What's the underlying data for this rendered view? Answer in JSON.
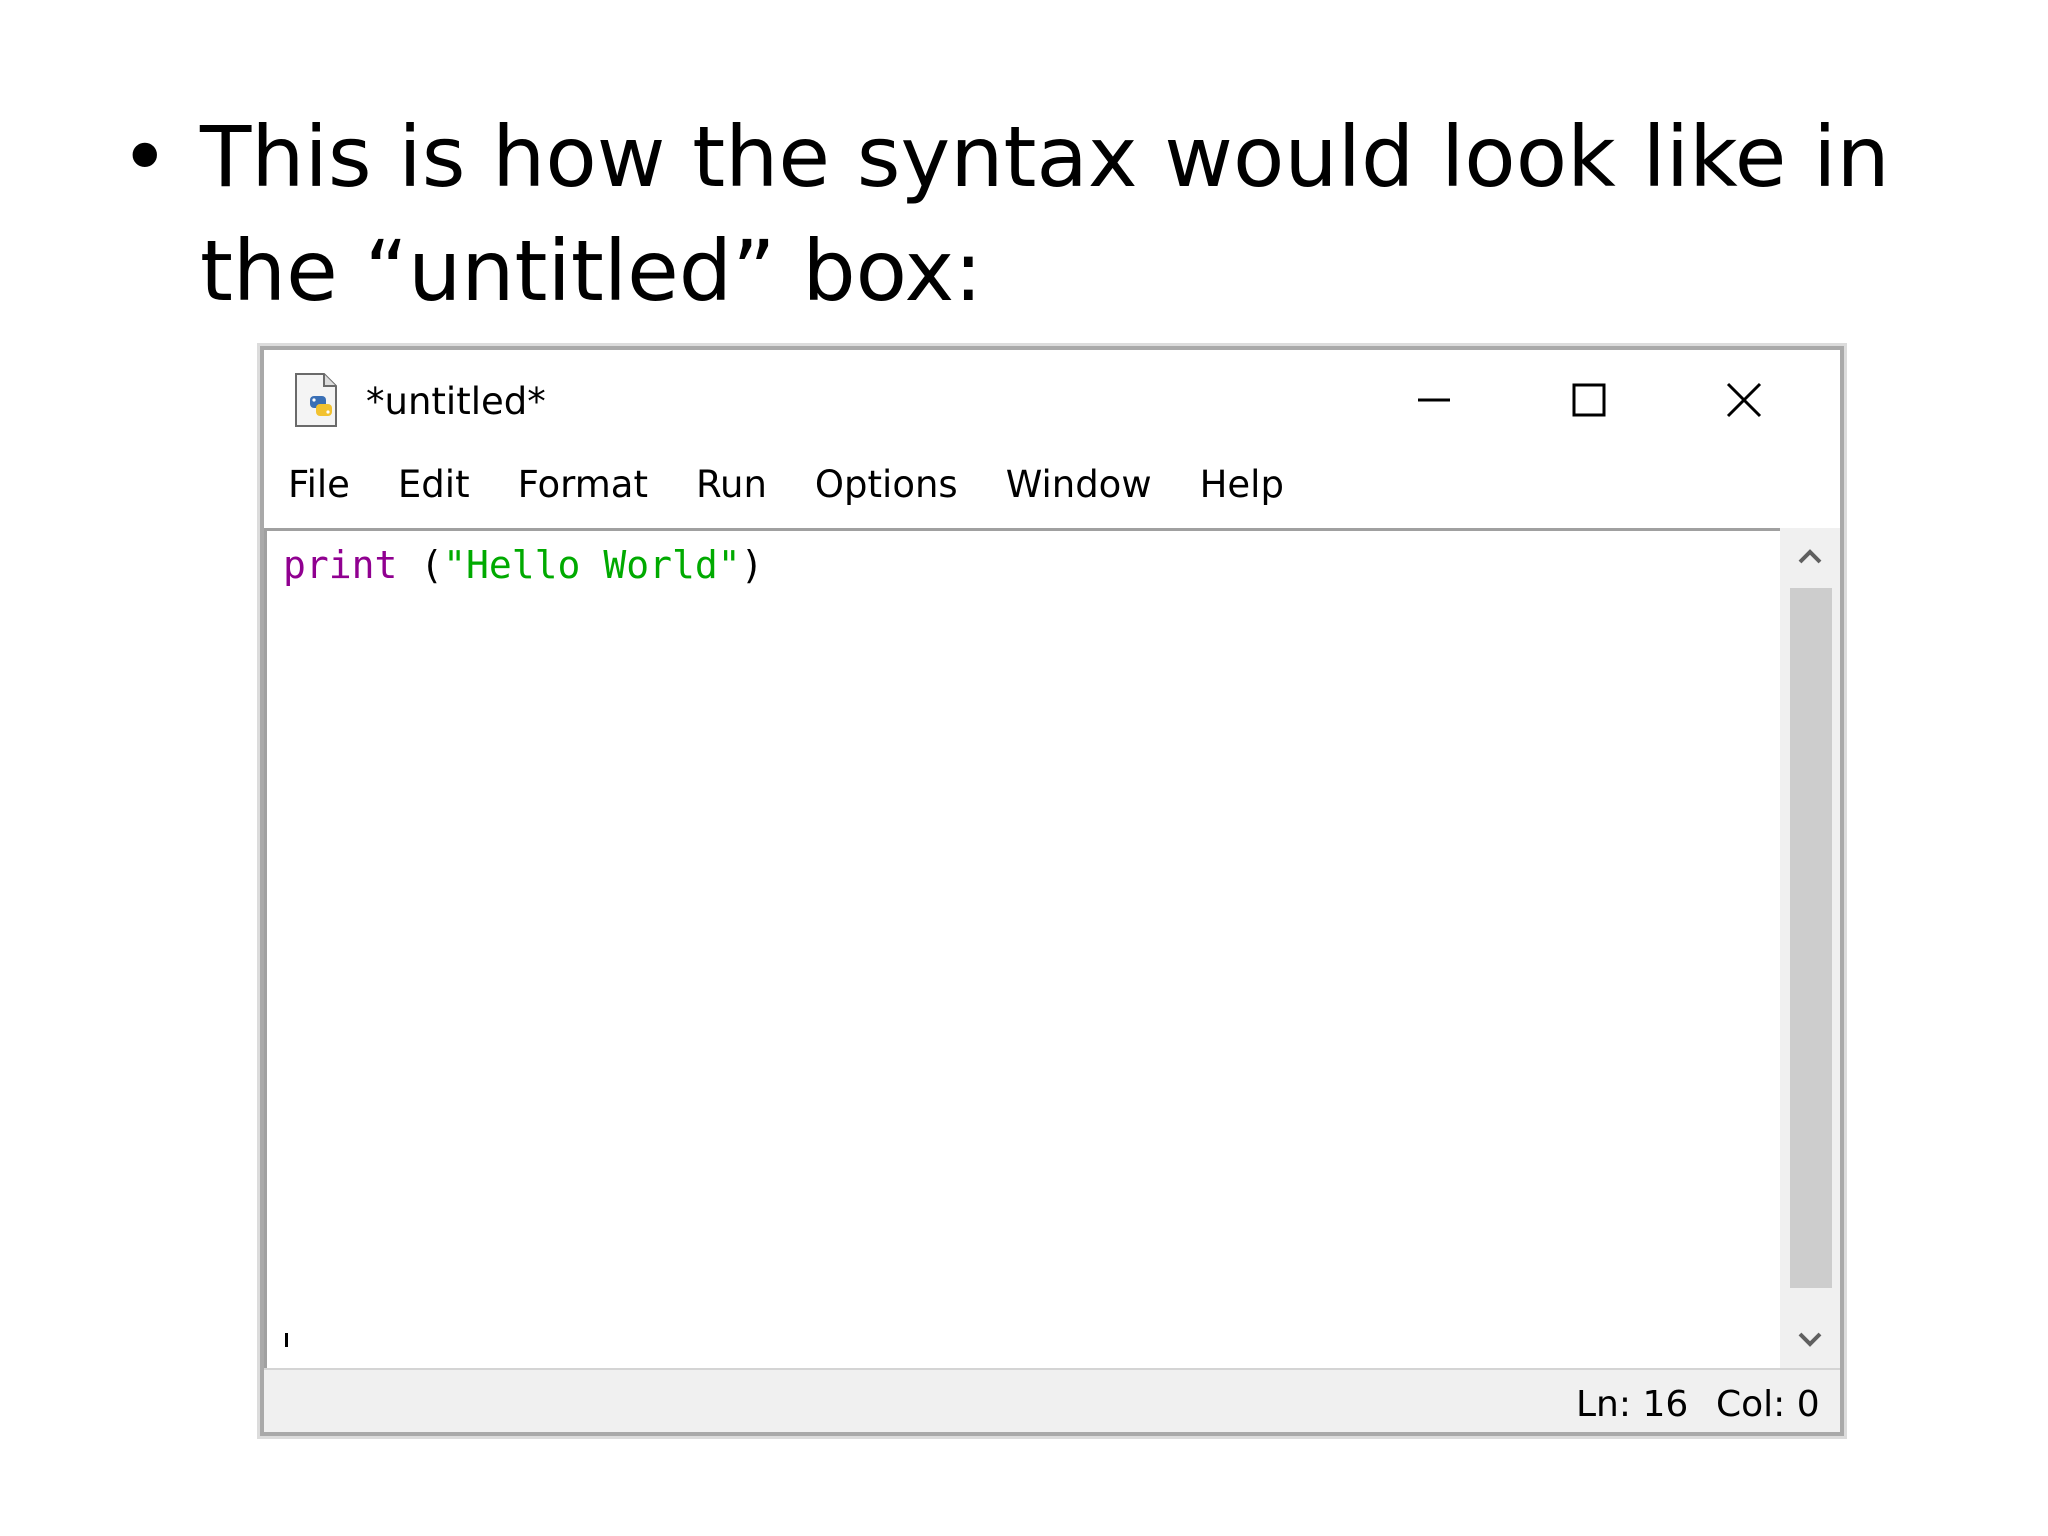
{
  "slide": {
    "bullet_text": "This is how the syntax would look like in the “untitled” box:"
  },
  "window": {
    "title": "*untitled*",
    "icon": "python-file-icon",
    "controls": {
      "minimize_icon": "minimize-icon",
      "maximize_icon": "maximize-icon",
      "close_icon": "close-icon"
    }
  },
  "menu": {
    "items": [
      "File",
      "Edit",
      "Format",
      "Run",
      "Options",
      "Window",
      "Help"
    ]
  },
  "editor": {
    "code": {
      "builtin": "print",
      "space": " ",
      "open": "(",
      "string": "\"Hello World\"",
      "close": ")"
    },
    "colors": {
      "builtin": "#900090",
      "string": "#00aa00",
      "plain": "#000000"
    }
  },
  "status": {
    "ln": "Ln: 16",
    "col": "Col: 0"
  }
}
